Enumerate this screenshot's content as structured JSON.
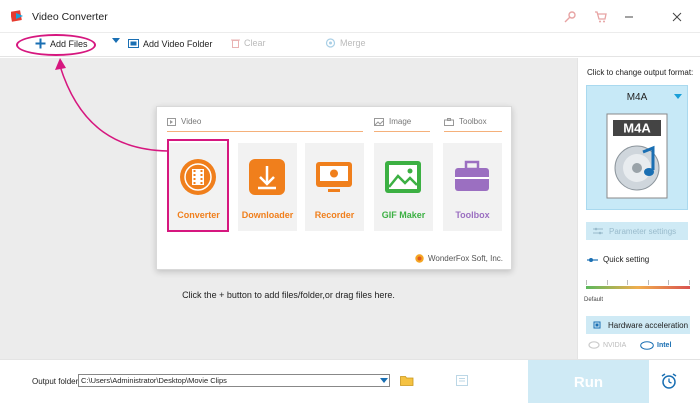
{
  "window": {
    "title": "Video Converter",
    "icons": [
      "key-icon",
      "cart-icon",
      "minimize-icon",
      "close-icon"
    ]
  },
  "toolbar": {
    "add_files": "Add Files",
    "add_video_folder": "Add Video Folder",
    "clear": "Clear",
    "merge": "Merge"
  },
  "home": {
    "categories": {
      "video": "Video",
      "image": "Image",
      "toolbox": "Toolbox"
    },
    "tiles": [
      {
        "label": "Converter",
        "color": "#f07f1c"
      },
      {
        "label": "Downloader",
        "color": "#f07f1c"
      },
      {
        "label": "Recorder",
        "color": "#f07f1c"
      },
      {
        "label": "GIF Maker",
        "color": "#3cb043"
      },
      {
        "label": "Toolbox",
        "color": "#9b6fc1"
      }
    ],
    "brand": "WonderFox Soft, Inc.",
    "drop_hint": "Click the + button to add files/folder,or drag files here."
  },
  "right_panel": {
    "title": "Click to change output format:",
    "format": "M4A",
    "format_badge": "M4A",
    "parameter_settings": "Parameter settings",
    "quick_setting": "Quick setting",
    "slider_default": "Default",
    "hardware_acceleration": "Hardware acceleration",
    "chips": [
      "NVIDIA",
      "Intel"
    ]
  },
  "bottom": {
    "output_folder_label": "Output folder:",
    "output_folder_value": "C:\\Users\\Administrator\\Desktop\\Movie Clips",
    "run": "Run"
  },
  "colors": {
    "accent": "#1a9fd8",
    "highlight": "#d6177f",
    "orange": "#f07f1c"
  }
}
